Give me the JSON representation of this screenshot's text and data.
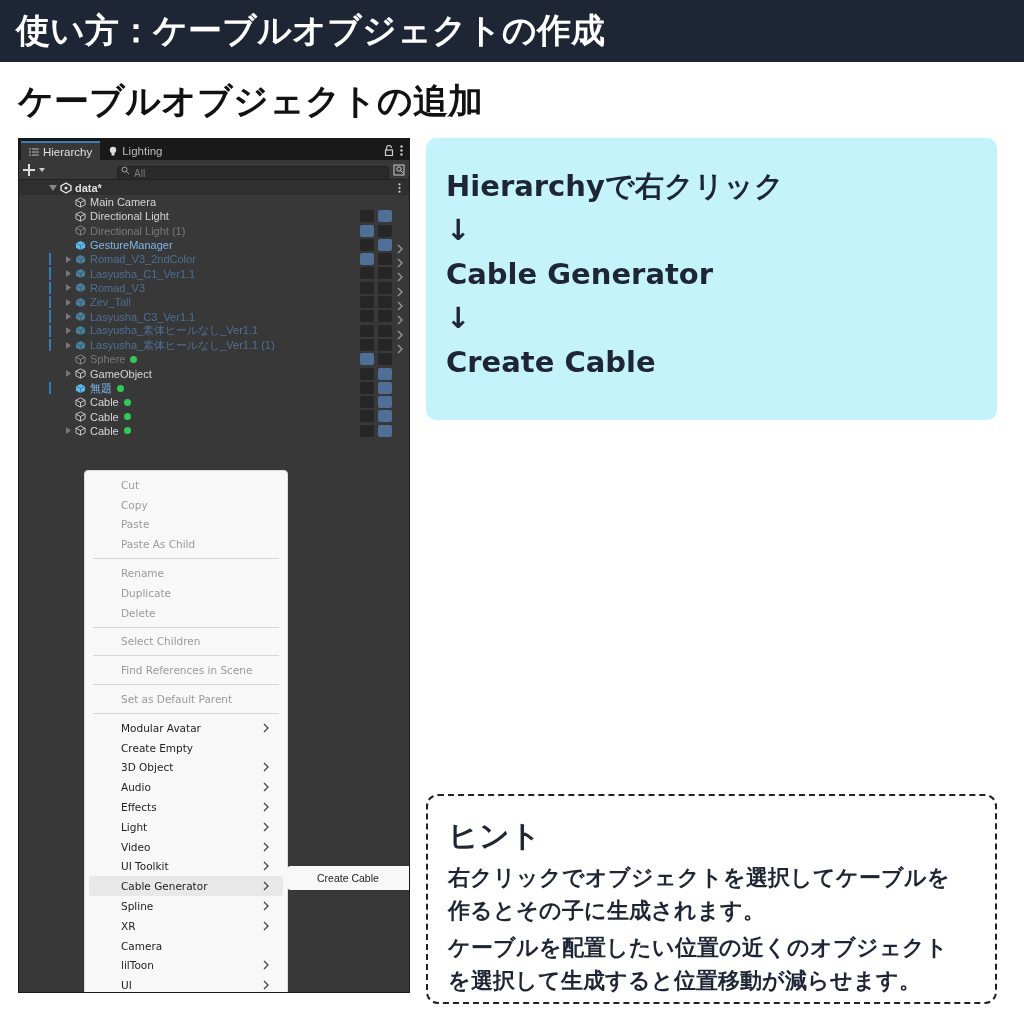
{
  "header": {
    "title": "使い方：ケーブルオブジェクトの作成"
  },
  "subtitle": "ケーブルオブジェクトの追加",
  "hierarchy": {
    "tabs": [
      {
        "label": "Hierarchy",
        "selected": true
      },
      {
        "label": "Lighting",
        "selected": false
      }
    ],
    "search": {
      "placeholder": "All"
    },
    "scene": {
      "label": "data*",
      "expanded": true,
      "children": [
        {
          "label": "Main Camera",
          "kind": "object",
          "disabled": false,
          "expandable": false,
          "marked": false,
          "dot": false,
          "chevron": false
        },
        {
          "label": "Directional Light",
          "kind": "object",
          "disabled": false,
          "expandable": false,
          "marked": false,
          "dot": false,
          "chevron": false,
          "hidden": false,
          "pickable": true
        },
        {
          "label": "Directional Light (1)",
          "kind": "object",
          "disabled": true,
          "expandable": false,
          "marked": false,
          "dot": false,
          "chevron": false,
          "hidden": true,
          "pickable": false
        },
        {
          "label": "GestureManager",
          "kind": "prefab",
          "disabled": false,
          "expandable": false,
          "marked": false,
          "dot": false,
          "chevron": true,
          "hidden": false,
          "pickable": true
        },
        {
          "label": "Romad_V3_2ndColor",
          "kind": "prefab",
          "disabled": true,
          "expandable": true,
          "marked": true,
          "dot": false,
          "chevron": true,
          "hidden": true,
          "pickable": false
        },
        {
          "label": "Lasyusha_C1_Ver1.1",
          "kind": "prefab",
          "disabled": true,
          "expandable": true,
          "marked": true,
          "dot": false,
          "chevron": true,
          "hidden": false,
          "pickable": false
        },
        {
          "label": "Romad_V3",
          "kind": "prefab",
          "disabled": true,
          "expandable": true,
          "marked": true,
          "dot": false,
          "chevron": true,
          "hidden": false,
          "pickable": false
        },
        {
          "label": "Zev_Tall",
          "kind": "prefab",
          "disabled": true,
          "expandable": true,
          "marked": true,
          "dot": false,
          "chevron": true,
          "hidden": false,
          "pickable": false
        },
        {
          "label": "Lasyusha_C3_Ver1.1",
          "kind": "prefab",
          "disabled": true,
          "expandable": true,
          "marked": true,
          "dot": false,
          "chevron": true,
          "hidden": false,
          "pickable": false
        },
        {
          "label": "Lasyusha_素体ヒールなし_Ver1.1",
          "kind": "prefab",
          "disabled": true,
          "expandable": true,
          "marked": true,
          "dot": false,
          "chevron": true,
          "hidden": false,
          "pickable": false
        },
        {
          "label": "Lasyusha_素体ヒールなし_Ver1.1 (1)",
          "kind": "prefab",
          "disabled": true,
          "expandable": true,
          "marked": true,
          "dot": false,
          "chevron": true,
          "hidden": false,
          "pickable": false
        },
        {
          "label": "Sphere",
          "kind": "object",
          "disabled": true,
          "expandable": false,
          "marked": false,
          "dot": true,
          "chevron": false,
          "hidden": true,
          "pickable": false
        },
        {
          "label": "GameObject",
          "kind": "object",
          "disabled": false,
          "expandable": true,
          "marked": false,
          "dot": false,
          "chevron": false,
          "hidden": false,
          "pickable": true
        },
        {
          "label": "無題",
          "kind": "prefab",
          "disabled": false,
          "expandable": false,
          "marked": true,
          "dot": true,
          "chevron": false,
          "hidden": false,
          "pickable": true
        },
        {
          "label": "Cable",
          "kind": "object",
          "disabled": false,
          "expandable": false,
          "marked": false,
          "dot": true,
          "chevron": false,
          "hidden": false,
          "pickable": true
        },
        {
          "label": "Cable",
          "kind": "object",
          "disabled": false,
          "expandable": false,
          "marked": false,
          "dot": true,
          "chevron": false,
          "hidden": false,
          "pickable": true
        },
        {
          "label": "Cable",
          "kind": "object",
          "disabled": false,
          "expandable": true,
          "marked": false,
          "dot": true,
          "chevron": false,
          "hidden": false,
          "pickable": true
        }
      ]
    },
    "context_menu": {
      "groups": [
        [
          {
            "label": "Cut",
            "disabled": true,
            "submenu": false,
            "selected": false
          },
          {
            "label": "Copy",
            "disabled": true,
            "submenu": false,
            "selected": false
          },
          {
            "label": "Paste",
            "disabled": true,
            "submenu": false,
            "selected": false
          },
          {
            "label": "Paste As Child",
            "disabled": true,
            "submenu": false,
            "selected": false
          }
        ],
        [
          {
            "label": "Rename",
            "disabled": true,
            "submenu": false,
            "selected": false
          },
          {
            "label": "Duplicate",
            "disabled": true,
            "submenu": false,
            "selected": false
          },
          {
            "label": "Delete",
            "disabled": true,
            "submenu": false,
            "selected": false
          }
        ],
        [
          {
            "label": "Select Children",
            "disabled": true,
            "submenu": false,
            "selected": false
          }
        ],
        [
          {
            "label": "Find References in Scene",
            "disabled": true,
            "submenu": false,
            "selected": false
          }
        ],
        [
          {
            "label": "Set as Default Parent",
            "disabled": true,
            "submenu": false,
            "selected": false
          }
        ],
        [
          {
            "label": "Modular Avatar",
            "disabled": false,
            "submenu": true,
            "selected": false
          },
          {
            "label": "Create Empty",
            "disabled": false,
            "submenu": false,
            "selected": false
          },
          {
            "label": "3D Object",
            "disabled": false,
            "submenu": true,
            "selected": false
          },
          {
            "label": "Audio",
            "disabled": false,
            "submenu": true,
            "selected": false
          },
          {
            "label": "Effects",
            "disabled": false,
            "submenu": true,
            "selected": false
          },
          {
            "label": "Light",
            "disabled": false,
            "submenu": true,
            "selected": false
          },
          {
            "label": "Video",
            "disabled": false,
            "submenu": true,
            "selected": false
          },
          {
            "label": "UI Toolkit",
            "disabled": false,
            "submenu": true,
            "selected": false
          },
          {
            "label": "Cable Generator",
            "disabled": false,
            "submenu": true,
            "selected": true
          },
          {
            "label": "Spline",
            "disabled": false,
            "submenu": true,
            "selected": false
          },
          {
            "label": "XR",
            "disabled": false,
            "submenu": true,
            "selected": false
          },
          {
            "label": "Camera",
            "disabled": false,
            "submenu": false,
            "selected": false
          },
          {
            "label": "lilToon",
            "disabled": false,
            "submenu": true,
            "selected": false
          },
          {
            "label": "UI",
            "disabled": false,
            "submenu": true,
            "selected": false
          }
        ]
      ],
      "submenu": [
        "Create Cable"
      ]
    }
  },
  "steps": [
    "Hierarchyで右クリック",
    "↓",
    "Cable Generator",
    "↓",
    "Create Cable"
  ],
  "hint": {
    "title": "ヒント",
    "paragraphs": [
      "右クリックでオブジェクトを選択してケーブルを作るとその子に生成されます。",
      "ケーブルを配置したい位置の近くのオブジェクトを選択して生成すると位置移動が減らせます。"
    ]
  }
}
